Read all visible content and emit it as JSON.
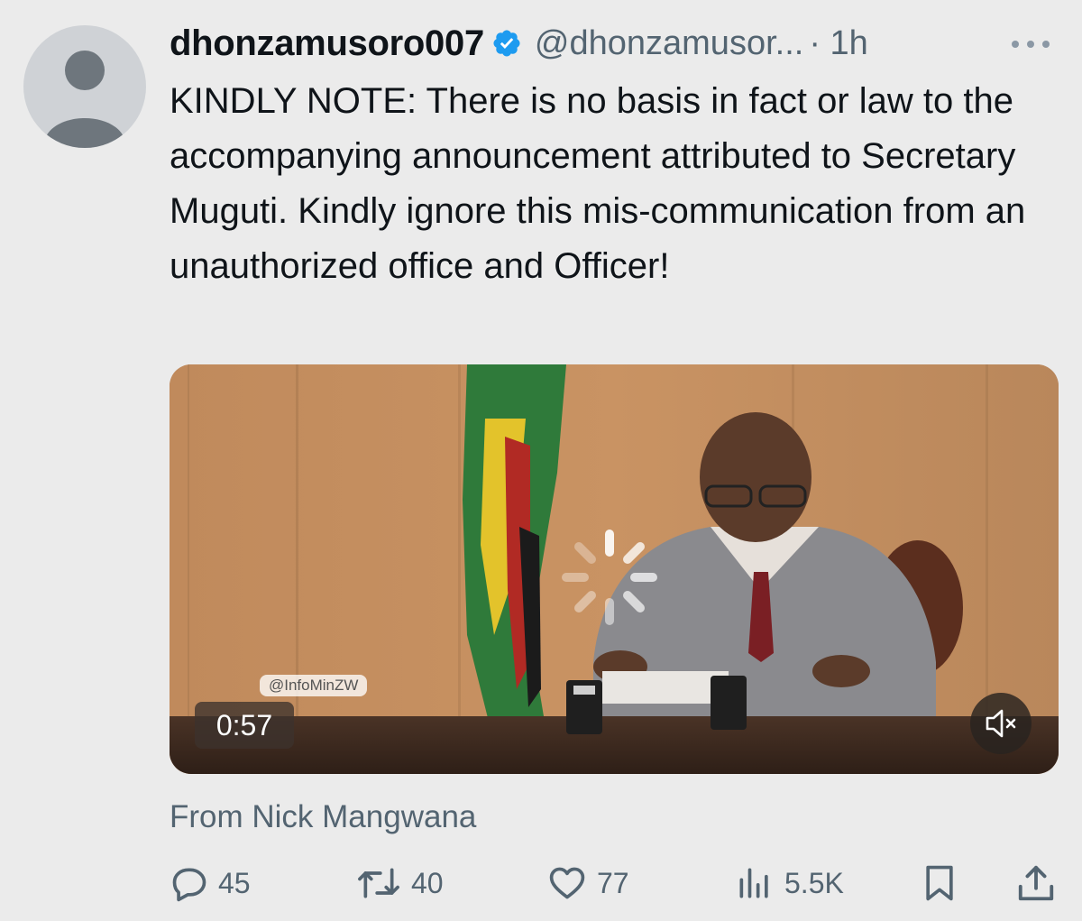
{
  "tweet": {
    "display_name": "dhonzamusoro007",
    "handle": "@dhonzamusor...",
    "time": "· 1h",
    "text": "KINDLY NOTE: There is no basis in fact or law to the accompanying announcement attributed to Secretary Muguti. Kindly ignore this mis-communication from an unauthorized office and Officer!",
    "source": "From Nick Mangwana"
  },
  "media": {
    "watermark": "@InfoMinZW",
    "duration": "0:57"
  },
  "actions": {
    "replies": "45",
    "reposts": "40",
    "likes": "77",
    "views": "5.5K"
  },
  "colors": {
    "verified": "#1d9bf0",
    "secondary_text": "#536471",
    "background": "#ebebeb"
  },
  "icons": [
    "avatar-placeholder",
    "verified-badge-icon",
    "more-icon",
    "loading-spinner-icon",
    "mute-icon",
    "reply-icon",
    "repost-icon",
    "like-icon",
    "views-icon",
    "bookmark-icon",
    "share-icon"
  ]
}
